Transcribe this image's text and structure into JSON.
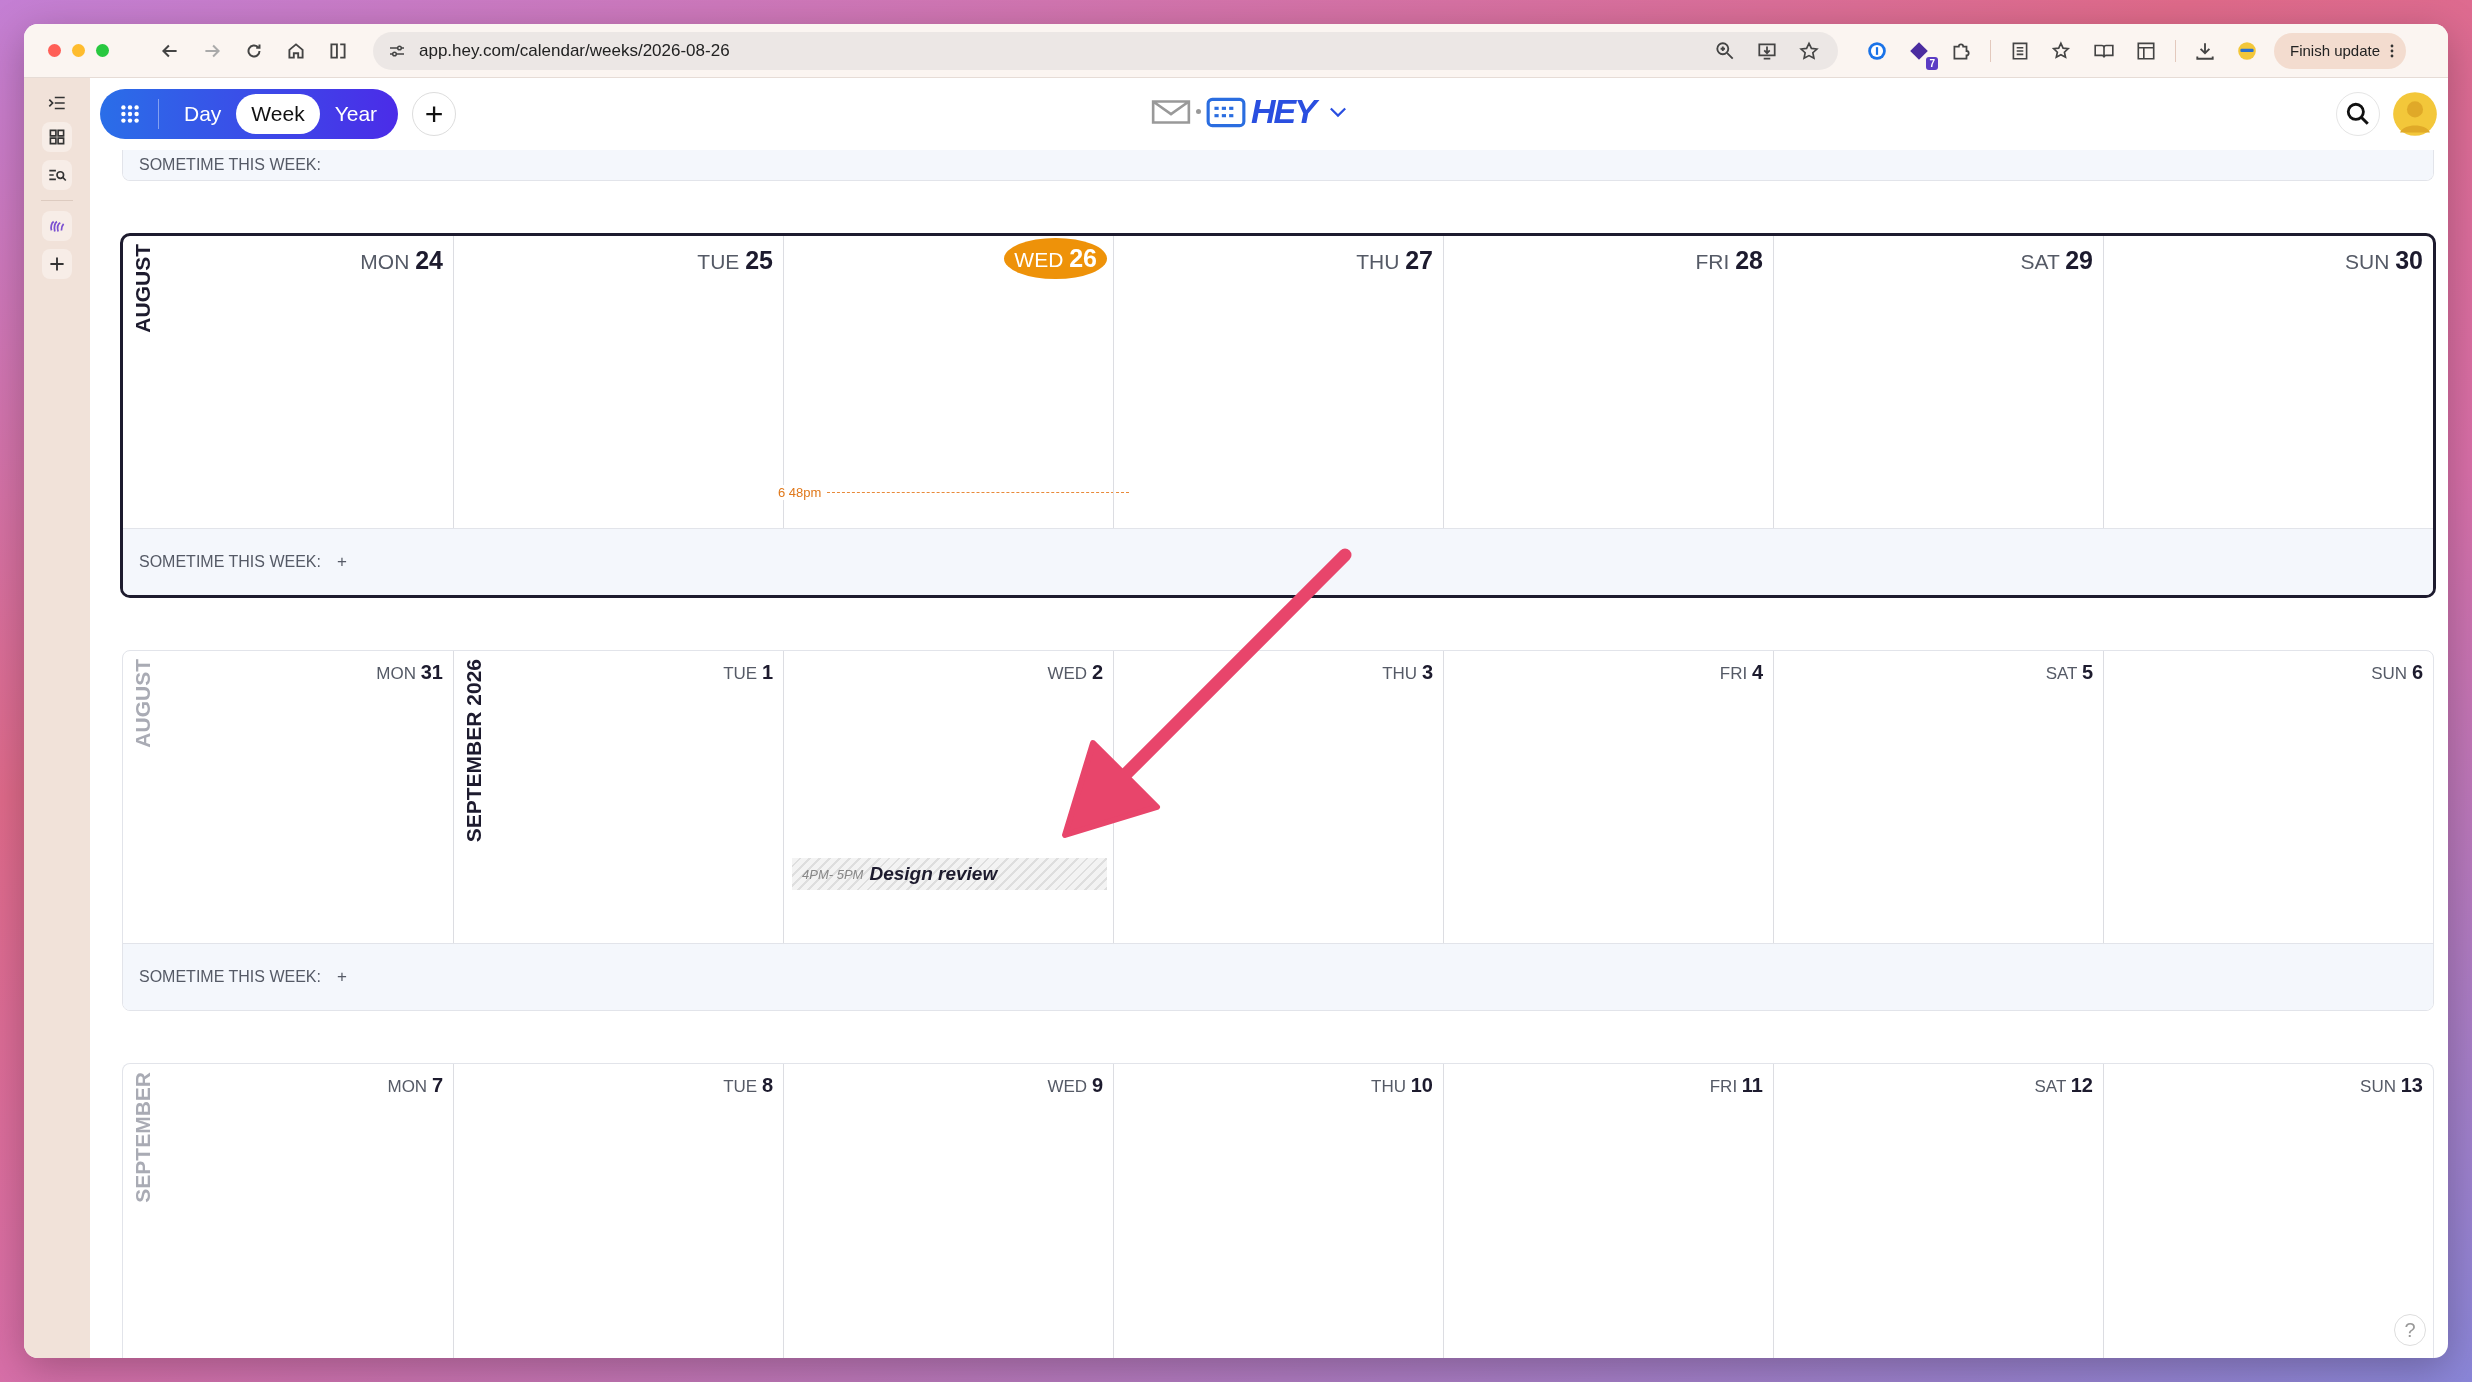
{
  "browser": {
    "url": "app.hey.com/calendar/weeks/2026-08-26",
    "extension_badge": "7",
    "update_button": "Finish update"
  },
  "toolbar": {
    "views": [
      {
        "label": "Day",
        "selected": false
      },
      {
        "label": "Week",
        "selected": true
      },
      {
        "label": "Year",
        "selected": false
      }
    ],
    "add_button": "+",
    "logo_text": "HEY"
  },
  "weeks": [
    {
      "current": false,
      "sometime": {
        "label": "SOMETIME THIS WEEK:"
      }
    },
    {
      "current": true,
      "days": [
        {
          "weekday": "MON",
          "date": "24",
          "today": false,
          "month_label": {
            "text": "AUGUST",
            "muted": false
          }
        },
        {
          "weekday": "TUE",
          "date": "25",
          "today": false
        },
        {
          "weekday": "WED",
          "date": "26",
          "today": true,
          "now_marker": "6 48pm"
        },
        {
          "weekday": "THU",
          "date": "27",
          "today": false
        },
        {
          "weekday": "FRI",
          "date": "28",
          "today": false
        },
        {
          "weekday": "SAT",
          "date": "29",
          "today": false
        },
        {
          "weekday": "SUN",
          "date": "30",
          "today": false
        }
      ],
      "sometime": {
        "label": "SOMETIME THIS WEEK:",
        "add_button": "+"
      }
    },
    {
      "current": false,
      "days": [
        {
          "weekday": "MON",
          "date": "31",
          "today": false,
          "month_label": {
            "text": "AUGUST",
            "muted": true
          }
        },
        {
          "weekday": "TUE",
          "date": "1",
          "today": false,
          "month_label": {
            "text": "SEPTEMBER 2026",
            "muted": false
          }
        },
        {
          "weekday": "WED",
          "date": "2",
          "today": false,
          "events": [
            {
              "time": "4PM- 5PM",
              "title": "Design review"
            }
          ]
        },
        {
          "weekday": "THU",
          "date": "3",
          "today": false
        },
        {
          "weekday": "FRI",
          "date": "4",
          "today": false
        },
        {
          "weekday": "SAT",
          "date": "5",
          "today": false
        },
        {
          "weekday": "SUN",
          "date": "6",
          "today": false
        }
      ],
      "sometime": {
        "label": "SOMETIME THIS WEEK:",
        "add_button": "+"
      }
    },
    {
      "current": false,
      "days": [
        {
          "weekday": "MON",
          "date": "7",
          "today": false,
          "month_label": {
            "text": "SEPTEMBER",
            "muted": true
          }
        },
        {
          "weekday": "TUE",
          "date": "8",
          "today": false
        },
        {
          "weekday": "WED",
          "date": "9",
          "today": false
        },
        {
          "weekday": "THU",
          "date": "10",
          "today": false
        },
        {
          "weekday": "FRI",
          "date": "11",
          "today": false
        },
        {
          "weekday": "SAT",
          "date": "12",
          "today": false
        },
        {
          "weekday": "SUN",
          "date": "13",
          "today": false
        }
      ]
    }
  ],
  "help_button": "?"
}
